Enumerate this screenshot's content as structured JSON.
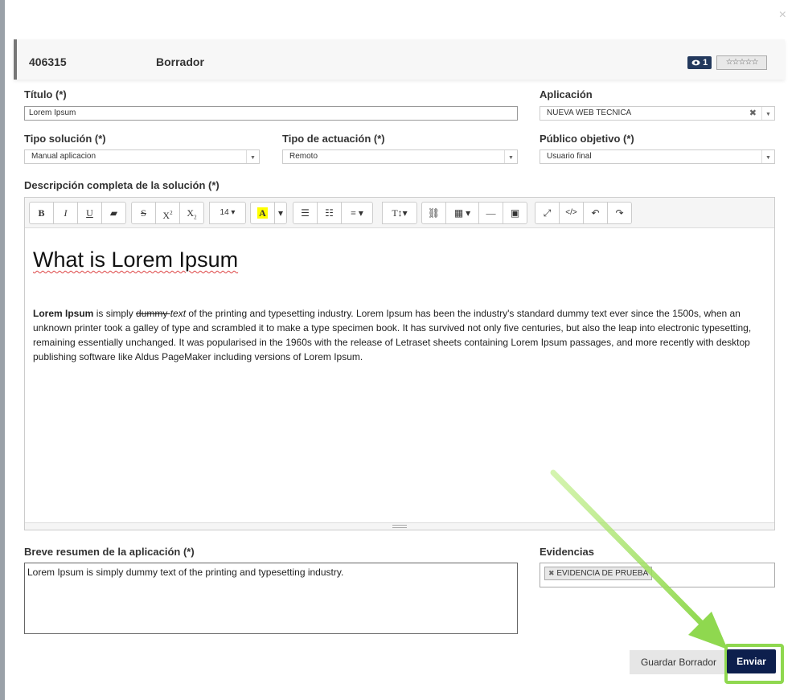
{
  "dialog": {
    "close_symbol": "×"
  },
  "header": {
    "id": "406315",
    "status": "Borrador",
    "views": "1",
    "stars": "☆☆☆☆☆"
  },
  "fields": {
    "titulo": {
      "label": "Título (*)",
      "value": "Lorem Ipsum"
    },
    "aplicacion": {
      "label": "Aplicación",
      "value": "NUEVA WEB TECNICA"
    },
    "tipo_solucion": {
      "label": "Tipo solución (*)",
      "value": "Manual aplicacion"
    },
    "tipo_actuacion": {
      "label": "Tipo de actuación (*)",
      "value": "Remoto"
    },
    "publico_objetivo": {
      "label": "Público objetivo (*)",
      "value": "Usuario final"
    },
    "descripcion": {
      "label": "Descripción completa de la solución (*)"
    },
    "resumen": {
      "label": "Breve resumen de la aplicación (*)",
      "value": "Lorem Ipsum is simply dummy text of the printing and typesetting industry."
    },
    "evidencias": {
      "label": "Evidencias",
      "tag": "EVIDENCIA DE PRUEBA"
    }
  },
  "editor": {
    "font_size": "14",
    "heading": "What is Lorem Ipsum",
    "para_bold": "Lorem Ipsum",
    "para_1": " is simply ",
    "para_strike": "dummy ",
    "para_italic": "text",
    "para_rest": " of the printing and typesetting industry. Lorem Ipsum has been the industry's standard dummy text ever since the 1500s, when an unknown printer took a galley of type and scrambled it to make a type specimen book. It has survived not only five centuries, but also the leap into electronic typesetting, remaining essentially unchanged. It was popularised in the 1960s with the release of Letraset sheets containing Lorem Ipsum passages, and more recently with desktop publishing software like Aldus PageMaker including versions of Lorem Ipsum."
  },
  "buttons": {
    "draft": "Guardar Borrador",
    "send": "Enviar"
  },
  "colors": {
    "primary": "#0d1f4d",
    "highlight": "#8fd84f"
  }
}
